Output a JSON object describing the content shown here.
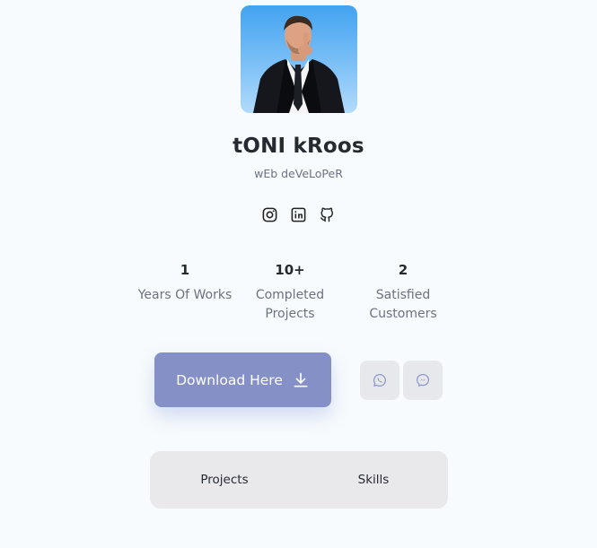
{
  "profile": {
    "name": "tONI kRoos",
    "role": "wEb deVeLoPeR"
  },
  "socials": [
    {
      "icon": "instagram-icon"
    },
    {
      "icon": "linkedin-icon"
    },
    {
      "icon": "github-icon"
    }
  ],
  "stats": [
    {
      "value": "1",
      "label": "Years Of Works"
    },
    {
      "value": "10+",
      "label": "Completed Projects"
    },
    {
      "value": "2",
      "label": "Satisfied Customers"
    }
  ],
  "actions": {
    "download_label": "Download Here",
    "download_icon": "download-icon",
    "contact_icons": [
      "whatsapp-icon",
      "messenger-icon"
    ]
  },
  "tabs": [
    {
      "label": "Projects"
    },
    {
      "label": "Skills"
    }
  ],
  "colors": {
    "background": "#f7fbfd",
    "accent": "#8590c6",
    "muted_button": "#e7e8eb",
    "tabs_bg": "#e9e9eb",
    "icon_muted": "#8f98c9"
  }
}
